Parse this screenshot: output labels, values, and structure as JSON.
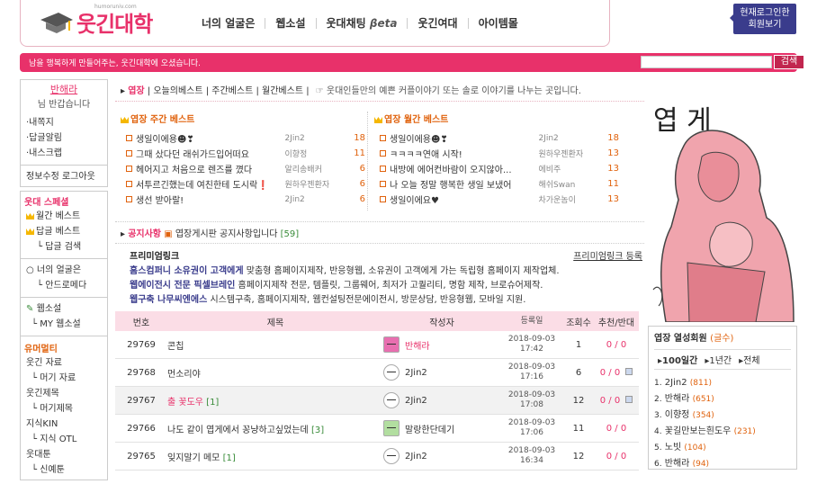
{
  "logo": {
    "text": "웃긴대학",
    "url": "humoruniv.com"
  },
  "nav": [
    "너의 얼굴은",
    "웹소설",
    "웃대채팅",
    "웃긴여대",
    "아이템몰"
  ],
  "nav_beta": "βeta",
  "login": {
    "line1": "현재로그인한",
    "line2": "회원보기"
  },
  "bar": {
    "message": "남을 행복하게 만들어주는, 웃긴대학에 오셨습니다.",
    "search_button": "검색"
  },
  "sidebar": {
    "user_name": "반해라",
    "greeting": "님 반갑습니다",
    "menu": [
      "·내쪽지",
      "·답글알림",
      "·내스크랩"
    ],
    "account": "정보수정 로그아웃",
    "section1": "웃대 스페셜",
    "s1_items": [
      "월간 베스트",
      "답글 베스트",
      "답글 검색"
    ],
    "s2_items": [
      "너의 얼굴은",
      "안드로메다"
    ],
    "s3_items": [
      "웹소설",
      "MY 웹소설"
    ],
    "section2": "유머멀티",
    "s4_items": [
      "웃긴 자료",
      "머기 자료",
      "웃긴제목",
      "머기제목",
      "지식KIN",
      "지식 OTL",
      "웃대툰",
      "신예툰"
    ]
  },
  "tabs": {
    "active": "엽장",
    "others": [
      "오늘의베스트",
      "주간베스트",
      "월간베스트"
    ],
    "desc": "웃대인들만의 예쁜 커플이야기 또는 솔로 이야기를 나누는 곳입니다."
  },
  "weekly": {
    "title": "엽장 주간 베스트",
    "rows": [
      {
        "t": "생일이에용☻❣",
        "a": "2Jin2",
        "n": "18"
      },
      {
        "t": "그때 샀다던 래쉬가드입어떠요",
        "a": "이향정",
        "n": "11"
      },
      {
        "t": "헤어지고 처음으로 렌즈를 꼈다",
        "a": "알리송배커",
        "n": "6"
      },
      {
        "t": "서투르긴했는데 여친한테 도시락❗",
        "a": "원하우젠환자",
        "n": "6"
      },
      {
        "t": "생선 받아랄!",
        "a": "2Jin2",
        "n": "6"
      }
    ]
  },
  "monthly": {
    "title": "엽장 월간 베스트",
    "rows": [
      {
        "t": "생일이에용☻❣",
        "a": "2Jin2",
        "n": "18"
      },
      {
        "t": "ㅋㅋㅋㅋ연애 시작!",
        "a": "원하우젠환자",
        "n": "13"
      },
      {
        "t": "내방에 에어컨바람이 오지않아...",
        "a": "에비주",
        "n": "13"
      },
      {
        "t": "나 오늘 정말 행복한 생일 보냈어",
        "a": "해쉬Swan",
        "n": "11"
      },
      {
        "t": "생일이에요♥",
        "a": "차가운놈이",
        "n": "13"
      }
    ]
  },
  "notice": {
    "label": "공지사항",
    "text": "엽장게시판 공지사항입니다",
    "count": "[59]"
  },
  "premium": {
    "title": "프리미엄링크",
    "register": "프리미엄링크 등록",
    "lines": [
      {
        "b": "홈스컴퍼니 소유권이 고객에게",
        "t": " 맞춤형 홈페이지제작, 반응형웹, 소유권이 고객에게 가는 독립형 홈페이지 제작업체."
      },
      {
        "b": "웹에이전시 전문 픽셀브레인",
        "t": " 홈페이지제작 전문, 템플릿, 그룹웨어, 최저가 고퀄리티, 명함 제작, 브로슈어제작."
      },
      {
        "b": "웹구축 나무씨엔에스",
        "t": " 시스템구축, 홈페이지제작, 웹컨설팅전문에이전시, 방문상담, 반응형웹, 모바일 지원."
      }
    ]
  },
  "table": {
    "headers": [
      "번호",
      "제목",
      "작성자",
      "등록일",
      "조회수",
      "추천/반대"
    ],
    "rows": [
      {
        "no": "29769",
        "title": "콘칩",
        "cm": "",
        "red": false,
        "author": "반해라",
        "date": "2018-09-03",
        "time": "17:42",
        "views": "1",
        "votes": "0 / 0",
        "av": "p",
        "img": false,
        "authorRed": true,
        "hi": false
      },
      {
        "no": "29768",
        "title": "먼소리야",
        "cm": "",
        "red": false,
        "author": "2Jin2",
        "date": "2018-09-03",
        "time": "17:16",
        "views": "6",
        "votes": "0 / 0",
        "av": "w",
        "img": true,
        "authorRed": false,
        "hi": false
      },
      {
        "no": "29767",
        "title": "출 꽃도우",
        "cm": "[1]",
        "red": true,
        "author": "2Jin2",
        "date": "2018-09-03",
        "time": "17:08",
        "views": "12",
        "votes": "0 / 0",
        "av": "w",
        "img": true,
        "authorRed": false,
        "hi": true
      },
      {
        "no": "29766",
        "title": "나도 같이 엽게에서 꽁냥하고싶었는데",
        "cm": "[3]",
        "red": false,
        "author": "말랑한단데기",
        "date": "2018-09-03",
        "time": "17:06",
        "views": "11",
        "votes": "0 / 0",
        "av": "g",
        "img": false,
        "authorRed": false,
        "hi": false
      },
      {
        "no": "29765",
        "title": "잊지말기 메모",
        "cm": "[1]",
        "red": false,
        "author": "2Jin2",
        "date": "2018-09-03",
        "time": "16:34",
        "views": "12",
        "votes": "0 / 0",
        "av": "w",
        "img": false,
        "authorRed": false,
        "hi": false
      }
    ]
  },
  "art": {
    "caption": "엽 게"
  },
  "fans": {
    "title": "엽장 열성회원",
    "title_note": "(글수)",
    "tabs": [
      "100일간",
      "1년간",
      "전체"
    ],
    "list": [
      {
        "r": "1.",
        "n": "2Jin2",
        "c": "(811)"
      },
      {
        "r": "2.",
        "n": "반해라",
        "c": "(651)"
      },
      {
        "r": "3.",
        "n": "이향정",
        "c": "(354)"
      },
      {
        "r": "4.",
        "n": "꽃길만보는흰도우",
        "c": "(231)"
      },
      {
        "r": "5.",
        "n": "노빗",
        "c": "(104)"
      },
      {
        "r": "6.",
        "n": "반해라",
        "c": "(94)"
      }
    ]
  },
  "colors": {
    "accent": "#e8316a",
    "orange": "#e0620d",
    "navy": "#3a3c8c"
  }
}
